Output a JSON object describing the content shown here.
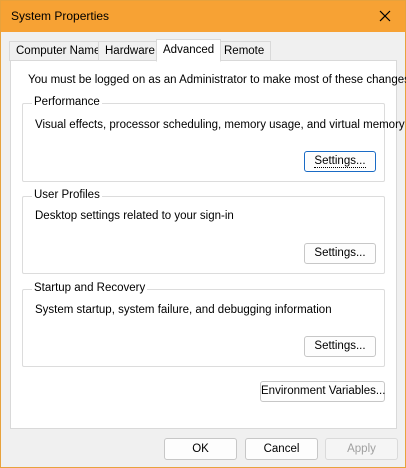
{
  "window": {
    "title": "System Properties",
    "accent": "#f7a234"
  },
  "tabs": [
    {
      "label": "Computer Name",
      "active": false
    },
    {
      "label": "Hardware",
      "active": false
    },
    {
      "label": "Advanced",
      "active": true
    },
    {
      "label": "Remote",
      "active": false
    }
  ],
  "advanced": {
    "note": "You must be logged on as an Administrator to make most of these changes.",
    "performance": {
      "title": "Performance",
      "description": "Visual effects, processor scheduling, memory usage, and virtual memory",
      "button": "Settings..."
    },
    "user_profiles": {
      "title": "User Profiles",
      "description": "Desktop settings related to your sign-in",
      "button": "Settings..."
    },
    "startup_recovery": {
      "title": "Startup and Recovery",
      "description": "System startup, system failure, and debugging information",
      "button": "Settings..."
    },
    "env_button": "Environment Variables..."
  },
  "footer": {
    "ok": "OK",
    "cancel": "Cancel",
    "apply": "Apply"
  }
}
